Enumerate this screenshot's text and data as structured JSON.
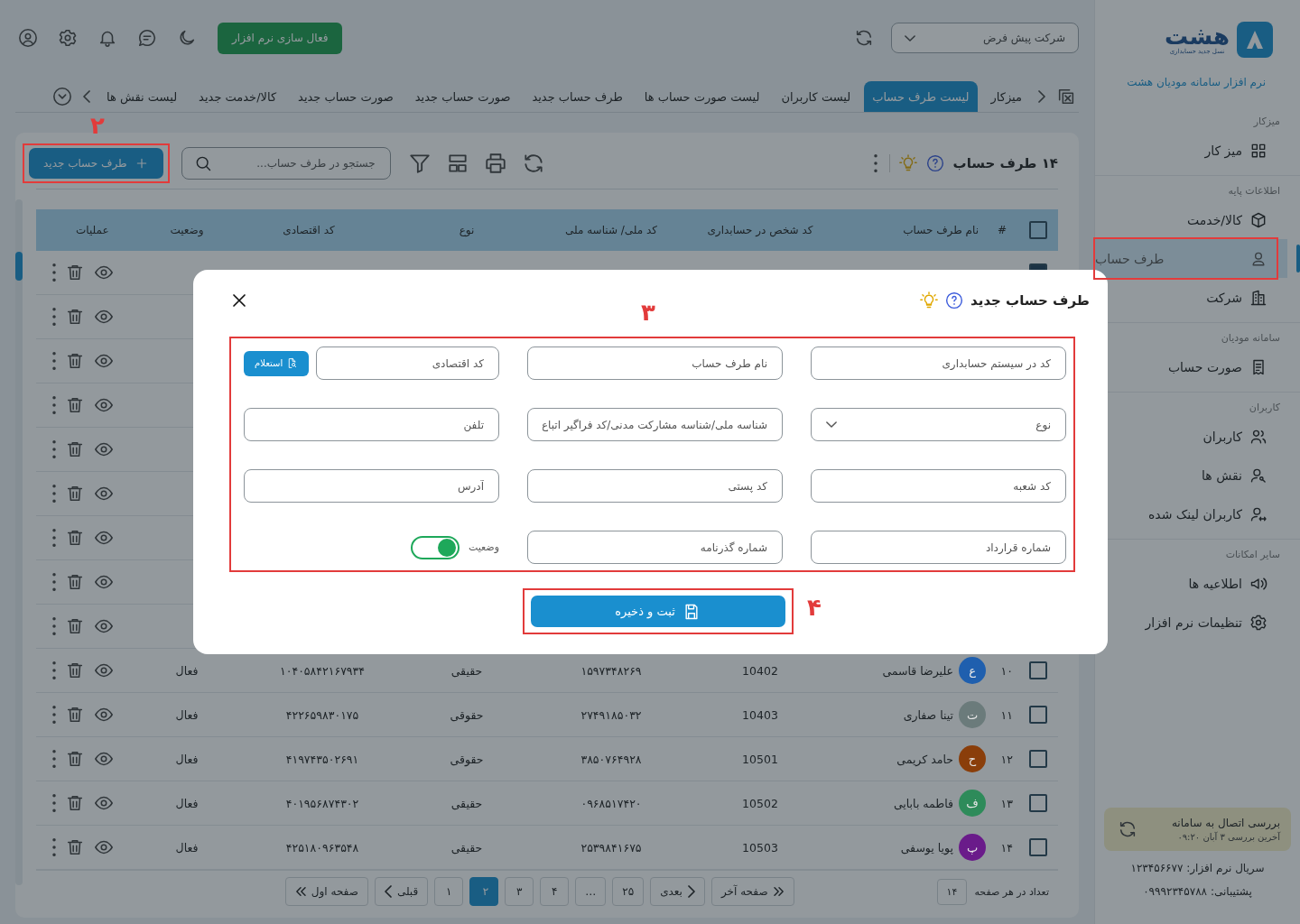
{
  "sidebar": {
    "logo": {
      "name": "هشت",
      "tagline": "نسل جدید حسابداری"
    },
    "product": "نرم افزار سامانه مودیان هشت",
    "sections": [
      {
        "title": "میزکار",
        "items": [
          {
            "label": "میز کار",
            "selected": false
          }
        ]
      },
      {
        "title": "اطلاعات پایه",
        "items": [
          {
            "label": "کالا/خدمت",
            "selected": false
          },
          {
            "label": "طرف حساب",
            "selected": true
          },
          {
            "label": "شرکت",
            "selected": false
          }
        ]
      },
      {
        "title": "سامانه مودیان",
        "items": [
          {
            "label": "صورت حساب",
            "selected": false
          }
        ]
      },
      {
        "title": "کاربران",
        "items": [
          {
            "label": "کاربران",
            "selected": false
          },
          {
            "label": "نقش ها",
            "selected": false
          },
          {
            "label": "کاربران لینک شده",
            "selected": false
          }
        ]
      },
      {
        "title": "سایر امکانات",
        "items": [
          {
            "label": "اطلاعیه ها",
            "selected": false
          },
          {
            "label": "تنظیمات نرم افزار",
            "selected": false
          }
        ]
      }
    ],
    "connection": {
      "title": "بررسی اتصال به سامانه",
      "last_check": "آخرین بررسی  ۳ آبان  ۰۹:۲۰"
    },
    "serial": "سریال نرم افزار: ۱۲۳۴۵۶۶۷۷",
    "support": "پشتیبانی: ۰۹۹۹۲۳۴۵۷۸۸"
  },
  "topbar": {
    "company_select": "شرکت پیش فرض",
    "activate_button": "فعال سازی نرم افزار"
  },
  "tabs": [
    {
      "label": "میزکار",
      "selected": false
    },
    {
      "label": "لیست طرف حساب",
      "selected": true
    },
    {
      "label": "لیست کاربران",
      "selected": false
    },
    {
      "label": "لیست صورت حساب ها",
      "selected": false
    },
    {
      "label": "طرف حساب جدید",
      "selected": false
    },
    {
      "label": "صورت حساب جدید",
      "selected": false
    },
    {
      "label": "صورت حساب جدید",
      "selected": false
    },
    {
      "label": "کالا/خدمت جدید",
      "selected": false
    },
    {
      "label": "لیست نقش ها",
      "selected": false
    }
  ],
  "list": {
    "title": "۱۴ طرف حساب",
    "new_button": "طرف حساب جدید",
    "search": {
      "placeholder": "جستجو در طرف حساب..."
    },
    "columns": [
      "#",
      "نام طرف حساب",
      "کد شخص در حسابداری",
      "کد ملی/ شناسه ملی",
      "نوع",
      "کد اقتصادی",
      "وضعیت",
      "عملیات"
    ],
    "select_all": {
      "checked": false
    },
    "rows": [
      {
        "checked": true
      },
      {},
      {},
      {},
      {},
      {},
      {},
      {},
      {},
      {
        "checked": false,
        "num": "۱۰",
        "initial": "ع",
        "color": "#1f5fae",
        "name": "علیرضا قاسمی",
        "code": "10402",
        "national_id": "۱۵۹۷۳۴۸۲۶۹",
        "type": "حقیقی",
        "economic_code": "۱۰۴۰۵۸۴۲۱۶۷۹۳۴",
        "status": "فعال"
      },
      {
        "checked": false,
        "num": "۱۱",
        "initial": "ت",
        "color": "#6b7b7b",
        "name": "تینا صفاری",
        "code": "10403",
        "national_id": "۲۷۴۹۱۸۵۰۳۲",
        "type": "حقوقی",
        "economic_code": "۴۲۲۶۵۹۸۳۰۱۷۵",
        "status": "فعال"
      },
      {
        "checked": false,
        "num": "۱۲",
        "initial": "ح",
        "color": "#8a3e0a",
        "name": "حامد کریمی",
        "code": "10501",
        "national_id": "۳۸۵۰۷۶۴۹۲۸",
        "type": "حقوقی",
        "economic_code": "۴۱۹۷۴۳۵۰۲۶۹۱",
        "status": "فعال"
      },
      {
        "checked": false,
        "num": "۱۳",
        "initial": "ف",
        "color": "#2e8b5a",
        "name": "فاطمه بابایی",
        "code": "10502",
        "national_id": "۰۹۶۸۵۱۷۴۲۰",
        "type": "حقیقی",
        "economic_code": "۴۰۱۹۵۶۸۷۴۳۰۲",
        "status": "فعال"
      },
      {
        "checked": false,
        "num": "۱۴",
        "initial": "پ",
        "color": "#6a1b8a",
        "name": "پویا یوسفی",
        "code": "10503",
        "national_id": "۲۵۳۹۸۴۱۶۷۵",
        "type": "حقیقی",
        "economic_code": "۴۲۵۱۸۰۹۶۳۵۴۸",
        "status": "فعال"
      }
    ],
    "pagination": {
      "per_page_label": "تعداد در هر صفحه",
      "per_page": "۱۴",
      "pages": [
        {
          "kind": "last",
          "label": "صفحه آخر",
          "selected": false
        },
        {
          "kind": "next",
          "label": "بعدی",
          "selected": false
        },
        {
          "kind": "page",
          "label": "۲۵",
          "selected": false
        },
        {
          "kind": "page",
          "label": "…",
          "selected": false
        },
        {
          "kind": "page",
          "label": "۴",
          "selected": false
        },
        {
          "kind": "page",
          "label": "۳",
          "selected": false
        },
        {
          "kind": "page",
          "label": "۲",
          "selected": true
        },
        {
          "kind": "page",
          "label": "۱",
          "selected": false
        },
        {
          "kind": "prev",
          "label": "قبلی",
          "selected": false
        },
        {
          "kind": "first",
          "label": "صفحه اول",
          "selected": false
        }
      ]
    }
  },
  "modal": {
    "title": "طرف حساب جدید",
    "fields": [
      {
        "kind": "text",
        "placeholder": "کد در سیستم حسابداری"
      },
      {
        "kind": "text",
        "placeholder": "نام طرف حساب"
      },
      {
        "kind": "inquiry",
        "placeholder": "کد اقتصادی",
        "button": "استعلام"
      },
      {
        "kind": "select",
        "placeholder": "نوع"
      },
      {
        "kind": "text",
        "placeholder": "شناسه ملی/شناسه مشارکت مدنی/کد فراگیر اتباع"
      },
      {
        "kind": "text",
        "placeholder": "تلفن"
      },
      {
        "kind": "text",
        "placeholder": "کد شعبه"
      },
      {
        "kind": "text",
        "placeholder": "کد پستی"
      },
      {
        "kind": "text",
        "placeholder": "آدرس"
      },
      {
        "kind": "text",
        "placeholder": "شماره قرارداد"
      },
      {
        "kind": "text",
        "placeholder": "شماره گذرنامه"
      },
      {
        "kind": "toggle",
        "label": "وضعیت",
        "on": true
      }
    ],
    "save_button": "ثبت و ذخیره"
  },
  "annotations": [
    {
      "label": "۲"
    },
    {
      "label": "۳"
    },
    {
      "label": "۴"
    }
  ]
}
